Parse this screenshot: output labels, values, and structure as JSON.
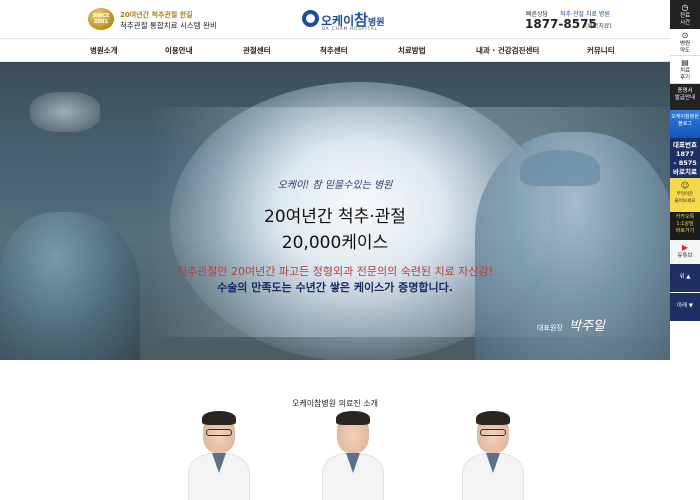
{
  "header": {
    "badge_line1": "SINCE",
    "badge_line2": "2001",
    "slogan_highlight": "20여년간 척추관절 한길",
    "slogan_main": "척추관절 통합치료 시스템 완비",
    "logo_prefix": "오케이",
    "logo_big": "참",
    "logo_suffix": "병원",
    "logo_sub": "OK CHAM HOSPITAL",
    "contact_label": "빠른상담",
    "contact_label2": "척추·관절 치료 병원",
    "phone": "1877-8575",
    "phone_note": "(바로치료)"
  },
  "nav": {
    "items": [
      "병원소개",
      "이용안내",
      "관절센터",
      "척추센터",
      "치료방법",
      "내과 · 건강검진센터",
      "커뮤니티"
    ]
  },
  "hero": {
    "tagline": "오케이! 참 믿을수있는 병원",
    "title_line1": "20여년간 척추·관절",
    "title_line2": "20,000케이스",
    "desc_line1": "척추관절만 20여년간 파고든 정형외과 전문의의 숙련된 치료 자신감!",
    "desc_line2": "수술의 만족도는 수년간 쌓은 케이스가 증명합니다.",
    "director_label": "대표원장",
    "director_signature": "박주일"
  },
  "section": {
    "title": "오케이참병원 의료진 소개"
  },
  "sidebar": {
    "items": [
      {
        "icon": "clock-icon",
        "label": "진료\n시간"
      },
      {
        "icon": "map-pin-icon",
        "label": "병원\n약도"
      },
      {
        "icon": "clipboard-icon",
        "label": "치료\n후기"
      },
      {
        "icon": "",
        "label": "증명서\n발급안내"
      },
      {
        "icon": "",
        "label": "오케이참병원\n블로그"
      },
      {
        "icon": "phone-icon",
        "label": "대표번호\n1877\n– 8575\n바로치료"
      },
      {
        "icon": "smile-icon",
        "label": "무엇이든\n물어보세요"
      },
      {
        "icon": "",
        "label": "카카오톡\n1:1상담\n바로가기"
      },
      {
        "icon": "play-icon",
        "label": "유튜브"
      },
      {
        "icon": "",
        "label": "위 ▲"
      },
      {
        "icon": "",
        "label": "아래 ▼"
      }
    ]
  }
}
